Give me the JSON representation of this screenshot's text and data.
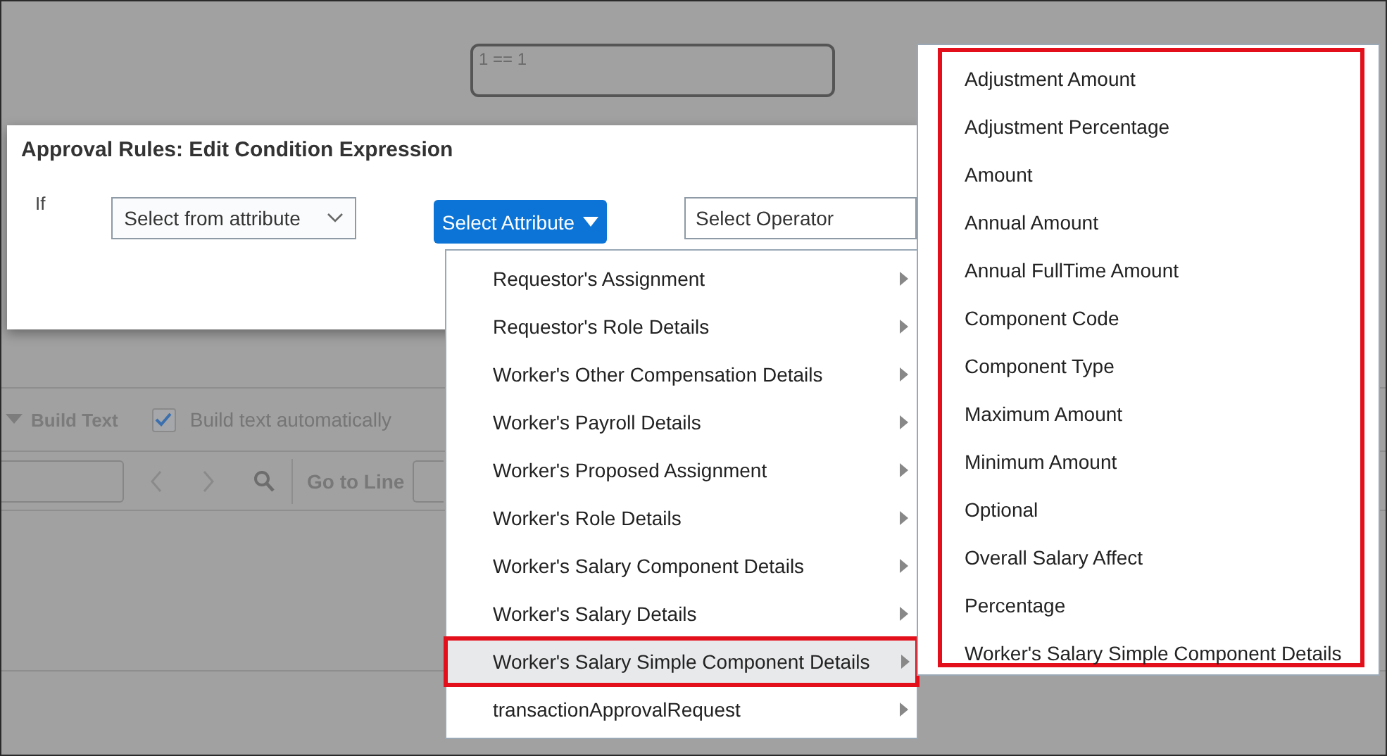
{
  "expression_box": {
    "value": "1 == 1"
  },
  "toolbar": {
    "build_text": "Build Text",
    "auto_build": {
      "label": "Build text automatically",
      "checked": true
    }
  },
  "find_bar": {
    "go_to_line": "Go to Line"
  },
  "dialog": {
    "title": "Approval Rules: Edit Condition Expression",
    "if_label": "If",
    "attribute_select": {
      "value": "Select from attribute"
    },
    "attribute_button": "Select Attribute",
    "operator_select": {
      "value": "Select Operator"
    }
  },
  "attribute_menu": {
    "items": [
      {
        "label": "Requestor's Assignment",
        "selected": false
      },
      {
        "label": "Requestor's Role Details",
        "selected": false
      },
      {
        "label": "Worker's Other Compensation Details",
        "selected": false
      },
      {
        "label": "Worker's Payroll Details",
        "selected": false
      },
      {
        "label": "Worker's Proposed Assignment",
        "selected": false
      },
      {
        "label": "Worker's Role Details",
        "selected": false
      },
      {
        "label": "Worker's Salary Component Details",
        "selected": false
      },
      {
        "label": "Worker's Salary Details",
        "selected": false
      },
      {
        "label": "Worker's Salary Simple Component Details",
        "selected": true
      },
      {
        "label": "transactionApprovalRequest",
        "selected": false
      }
    ]
  },
  "submenu": {
    "highlighted": true,
    "items": [
      "Adjustment Amount",
      "Adjustment Percentage",
      "Amount",
      "Annual Amount",
      "Annual FullTime Amount",
      "Component Code",
      "Component Type",
      "Maximum Amount",
      "Minimum Amount",
      "Optional",
      "Overall Salary Affect",
      "Percentage",
      "Worker's Salary Simple Component Details"
    ]
  }
}
